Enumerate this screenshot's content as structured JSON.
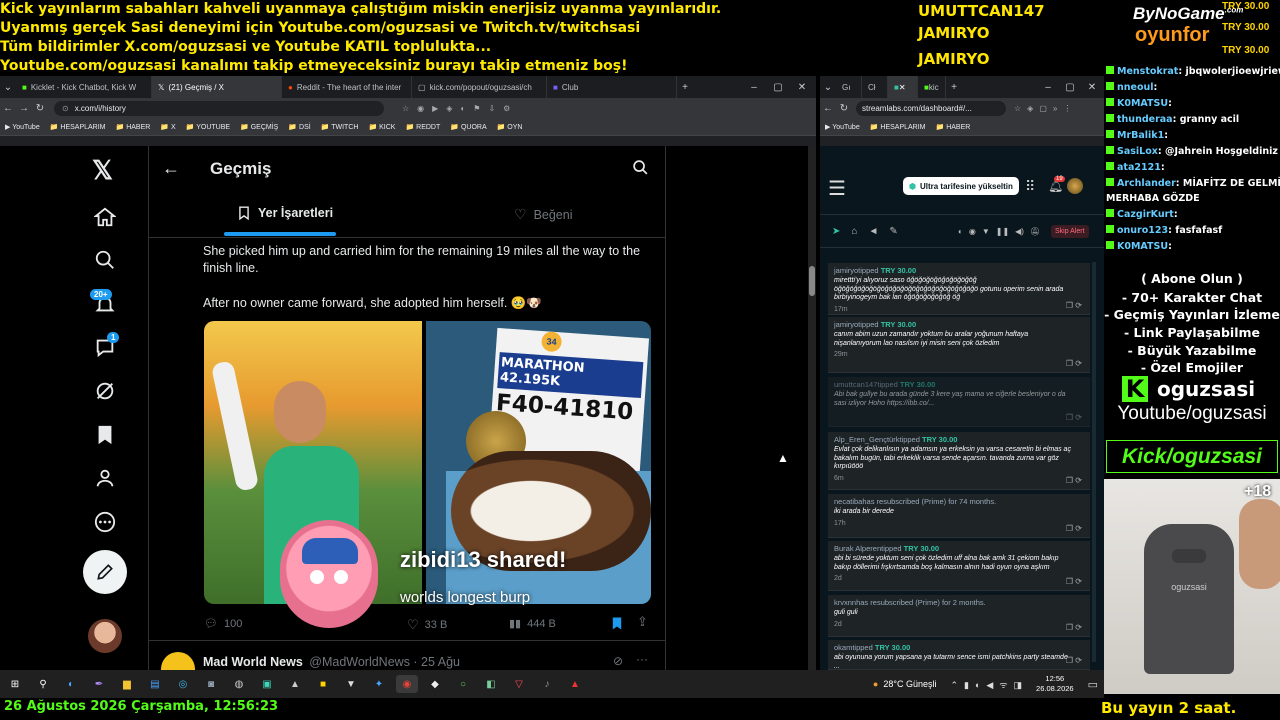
{
  "overlay": {
    "ticker_lines": [
      "Kick yayınlarım sabahları kahveli uyanmaya çalıştığım miskin enerjisiz uyanma yayınlarıdır.",
      "Uyanmış gerçek Sasi deneyimi için Youtube.com/oguzsasi ve Twitch.tv/twitchsasi",
      "Tüm bildirimler X.com/oguzsasi ve Youtube KATIL toplulukta...",
      "Youtube.com/oguzsasi kanalımı takip etmeyeceksiniz burayı takip etmeniz boş!"
    ],
    "donors": [
      "UMUTTCAN147",
      "JAMIRYO",
      "JAMIRYO"
    ],
    "brand_top": "ByNoGame",
    "brand_com": ".com",
    "brand_bottom": "oyunfor",
    "try_values": [
      "TRY 30.00",
      "TRY 30.00",
      "TRY 30.00"
    ],
    "bottom_datetime": "26 Ağustos 2026 Çarşamba, 12:56:23",
    "bottom_right": "Bu yayın 2 saat.",
    "cam_count": "+18",
    "ad_lines": [
      "( Abone Olun )",
      "- 70+ Karakter Chat",
      "- Geçmiş Yayınları İzleme",
      "- Link Paylaşabilme",
      "- Büyük Yazabilme",
      "- Özel Emojiler"
    ],
    "kick_name": "oguzsasi",
    "youtube_handle": "Youtube/oguzsasi",
    "kick_handle": "Kick/oguzsasi",
    "chair_brand": "oguzsasi"
  },
  "chat": [
    {
      "name": "Menstokrat",
      "text": ": jbqwolerjioewjriewq"
    },
    {
      "name": "nneoul",
      "text": ":"
    },
    {
      "name": "K0MATSU",
      "text": ":"
    },
    {
      "name": "thunderaa",
      "text": ": granny acil"
    },
    {
      "name": "MrBalik1",
      "text": ":"
    },
    {
      "name": "SasiLox",
      "text": ": @Jahrein Hoşgeldiniz"
    },
    {
      "name": "ata2121",
      "text": ":"
    },
    {
      "name": "Archlander",
      "text": ": MİAFİTZ DE GELMİŞ"
    },
    {
      "name": "",
      "text": "MERHABA GÖZDE"
    },
    {
      "name": "CazgirKurt",
      "text": ":"
    },
    {
      "name": "onuro123",
      "text": ": fasfafasf"
    },
    {
      "name": "K0MATSU",
      "text": ":"
    }
  ],
  "left_browser": {
    "tabs": [
      "Kicklet - Kick Chatbot, Kick W",
      "(21) Geçmiş / X",
      "Reddit - The heart of the inter",
      "kick.com/popout/oguzsasi/ch",
      "Club"
    ],
    "url": "x.com/i/history",
    "bookmarks": [
      "YouTube",
      "HESAPLARIM",
      "HABER",
      "X",
      "YOUTUBE",
      "GEÇMİŞ",
      "DSİ",
      "TWITCH",
      "KICK",
      "REDDT",
      "QUORA",
      "OYN"
    ]
  },
  "x_page": {
    "title": "Geçmiş",
    "tab_bookmarks": "Yer İşaretleri",
    "tab_likes": "Beğeni",
    "notif_badge": "20+",
    "msg_badge": "1",
    "post_text_1": "She picked him up and carried him for the remaining 19 miles all the way to the finish line.",
    "post_text_2": "After no owner came forward, she adopted him herself. 🥹🐶",
    "bib_race": "MARATHON 42.195K",
    "bib_number": "F40-41810",
    "bib_year": "34",
    "stat_replies": "100",
    "stat_likes": "33 B",
    "stat_views": "444 B",
    "next_author": "Mad World News",
    "next_handle": "@MadWorldNews · 25 Ağu",
    "share_title": "zibidi13 shared!",
    "share_sub": "worlds longest burp"
  },
  "right_browser": {
    "tabs": [
      "Gı",
      "Cł",
      "",
      "kic"
    ],
    "url": "streamlabs.com/dashboard#/...",
    "bookmarks": [
      "YouTube",
      "HESAPLARIM",
      "HABER"
    ],
    "upgrade": "Ultra tarifesine yükseltin",
    "notif": "19",
    "skip": "Skip Alert"
  },
  "alerts": [
    {
      "who": "jamiryo",
      "verb": "tipped",
      "amount": "TRY 30.00",
      "msg": "mirettti'yi alıyoruz saso öğöğöğöğöğöğöğöğöğ öğöğöğöğöğöğöğöğöğöğöğöğöğöğöğöğöğöğö gotunu operim senin arada birbiyinogeym bak lan öğöğöğöğöğöğ öğ",
      "time": "17m",
      "dim": false
    },
    {
      "who": "jamiryo",
      "verb": "tipped",
      "amount": "TRY 30.00",
      "msg": "canım abim uzun zamandır yoktum bu aralar yoğunum haftaya nişanlanıyorum lao nasılsın iyi misin seni çok özledim",
      "time": "29m",
      "dim": false
    },
    {
      "who": "umuttcan147",
      "verb": "tipped",
      "amount": "TRY 30.00",
      "msg": "Abi bak gullye bu arada günde 3 kere yaş mama ve ciğerle besleniyor o da sasi izliyor Hoho https://ibb.co/...",
      "time": "",
      "dim": true
    },
    {
      "who": "Alp_Eren_Gençtürk",
      "verb": "tipped",
      "amount": "TRY 30.00",
      "msg": "Evlat çok delikanlısın ya adamsın ya erkeksin ya varsa cesaretin bi elmas aç bakalım bugün, tabi erkeklik varsa sende açarsın. tavanda zurna var göz kırpıüööö",
      "time": "6m",
      "dim": false
    },
    {
      "who": "necatiba",
      "verb": "has resubscribed (Prime) for 74 months.",
      "amount": "",
      "msg": "iki arada bir derede",
      "time": "17h",
      "dim": false
    },
    {
      "who": "Burak Alperen",
      "verb": "tipped",
      "amount": "TRY 30.00",
      "msg": "abi bi sürede yoktum seni çok özledim uff alna bak amk 31 çekiom bakıp bakıp döllerimi fışkırtsamda boş kalmasın alnın hadi oyun oyna aşkım",
      "time": "2d",
      "dim": false
    },
    {
      "who": "krvxnn",
      "verb": "has resubscribed (Prime) for 2 months.",
      "amount": "",
      "msg": "guli guli",
      "time": "2d",
      "dim": false
    },
    {
      "who": "okam",
      "verb": "tipped",
      "amount": "TRY 30.00",
      "msg": "abi oyununa yorum yapsana ya tutarmı sence ismi patchkins party steamde ...",
      "time": "",
      "dim": false
    }
  ],
  "taskbar": {
    "weather": "28°C  Güneşli",
    "time": "12:56",
    "date": "26.08.2026"
  }
}
